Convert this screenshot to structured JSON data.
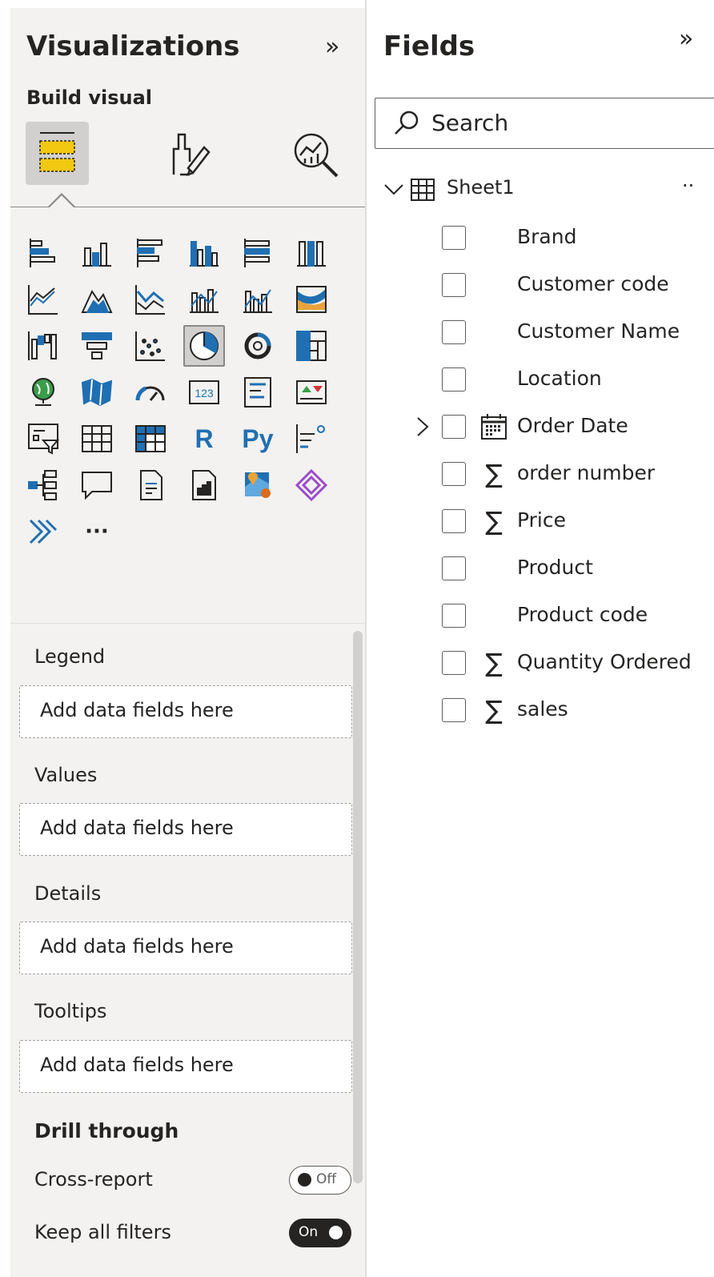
{
  "visualizations": {
    "title": "Visualizations",
    "build_label": "Build visual",
    "gallery_text": {
      "r": "R",
      "py": "Py",
      "more": "···"
    },
    "wells": [
      {
        "label": "Legend",
        "placeholder": "Add data fields here"
      },
      {
        "label": "Values",
        "placeholder": "Add data fields here"
      },
      {
        "label": "Details",
        "placeholder": "Add data fields here"
      },
      {
        "label": "Tooltips",
        "placeholder": "Add data fields here"
      }
    ],
    "drill_through": {
      "title": "Drill through",
      "cross_report": {
        "label": "Cross-report",
        "state": "Off"
      },
      "keep_all_filters": {
        "label": "Keep all filters",
        "state": "On"
      }
    }
  },
  "fields": {
    "title": "Fields",
    "search_placeholder": "Search",
    "table": {
      "name": "Sheet1",
      "items": [
        {
          "name": "Brand",
          "type": ""
        },
        {
          "name": "Customer code",
          "type": ""
        },
        {
          "name": "Customer Name",
          "type": ""
        },
        {
          "name": "Location",
          "type": ""
        },
        {
          "name": "Order Date",
          "type": "calendar-icon"
        },
        {
          "name": "order number",
          "type": "sigma-icon"
        },
        {
          "name": "Price",
          "type": "sigma-icon"
        },
        {
          "name": "Product",
          "type": ""
        },
        {
          "name": "Product code",
          "type": ""
        },
        {
          "name": "Quantity Ordered",
          "type": "sigma-icon"
        },
        {
          "name": "sales",
          "type": "sigma-icon"
        }
      ]
    }
  },
  "colors": {
    "accent_blue": "#1f6fb2",
    "accent_yellow": "#f2c811",
    "pane_bg": "#f3f2f1",
    "text": "#252423"
  }
}
